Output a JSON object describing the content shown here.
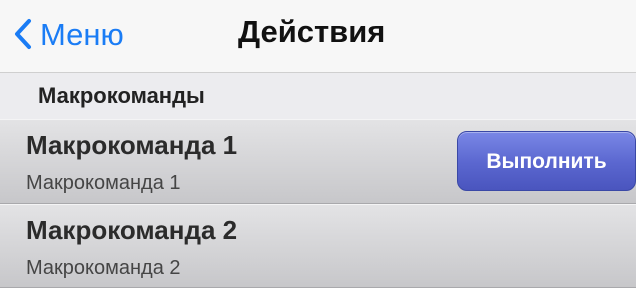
{
  "navbar": {
    "back_label": "Меню",
    "back_icon": "chevron-left-icon",
    "title": "Действия",
    "accent_color": "#1a7cf5"
  },
  "section": {
    "title": "Макрокоманды"
  },
  "rows": [
    {
      "title": "Макрокоманда 1",
      "subtitle": "Макрокоманда 1",
      "action_label": "Выполнить"
    },
    {
      "title": "Макрокоманда 2",
      "subtitle": "Макрокоманда 2"
    }
  ],
  "colors": {
    "button": "#5a66cf",
    "row_background": "#d6d6d8"
  }
}
